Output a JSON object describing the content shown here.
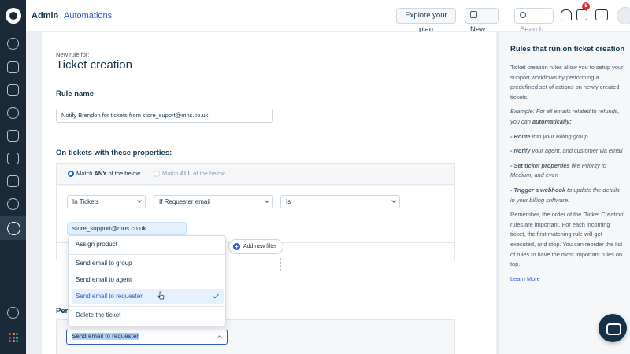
{
  "colors": {
    "rail": "#1a2a38",
    "accent": "#2c5cc5",
    "badge": "#d72d30",
    "text": "#12344d"
  },
  "rail": {
    "icons": [
      "headset-logo-icon",
      "dashboard-icon",
      "tickets-icon",
      "contacts-icon",
      "groups-icon",
      "knowledge-base-icon",
      "copy-icon",
      "reports-icon",
      "compass-icon",
      "admin-gear-icon",
      "chat-bubble-icon",
      "apps-grid-icon"
    ],
    "dot_colors": [
      "#e74c3c",
      "#f5a623",
      "#27ae60",
      "#2c5cc5",
      "#9b59b6",
      "#1abc9c",
      "#e74c3c",
      "#f5a623",
      "#27ae60"
    ]
  },
  "header": {
    "breadcrumb_root": "Admin",
    "breadcrumb_sep": "›",
    "breadcrumb_current": "Automations",
    "explore_label": "Explore your plan",
    "new_label": "New",
    "search_placeholder": "Search",
    "notification_badge": "5"
  },
  "form": {
    "subtitle": "New rule for:",
    "title": "Ticket creation",
    "rule_name_label": "Rule name",
    "rule_name_value": "Notify Brendon for tickets from store_suport@mns.co.uk",
    "properties_label": "On tickets with these properties:",
    "match_any_prefix": "Match ",
    "match_any_bold": "ANY",
    "match_any_suffix": " of the below",
    "match_all_prefix": "Match ",
    "match_all_bold": "ALL",
    "match_all_suffix": " of the below",
    "condition": {
      "scope": "In Tickets",
      "field": "If Requester email",
      "operator": "Is",
      "value": "store_support@mns.co.uk"
    },
    "add_filter_label": "Add new filter",
    "perform_label": "Per",
    "action_value": "Send email to requester"
  },
  "dropdown": {
    "items": [
      "Assign product",
      "Send email to group",
      "Send email to agent",
      "Send email to requester",
      "Delete the ticket"
    ],
    "selected_index": 3
  },
  "help": {
    "title": "Rules that run on ticket creation",
    "intro": "Ticket creation rules allow you to setup your support workflows by performing a predefined set of actions on newly created tickets.",
    "example": "Example: For all emails related to refunds, you can ",
    "example_bold": "automatically:",
    "b1_bold": "- Route",
    "b1_rest": " it to your Billing group",
    "b2_bold": "- Notify",
    "b2_rest": " your agent, and customer via email",
    "b3_bold": "- Set ticket properties",
    "b3_rest": " like Priority to Medium, and even",
    "b4_bold": "- Trigger a webhook",
    "b4_rest": " to update the details in your billing software.",
    "outro": "Remember, the order of the 'Ticket Creation' rules are important. For each incoming ticket, the first matching rule will get executed, and stop. You can reorder the list of rules to have the most important rules on top.",
    "learn_more": "Learn More"
  }
}
